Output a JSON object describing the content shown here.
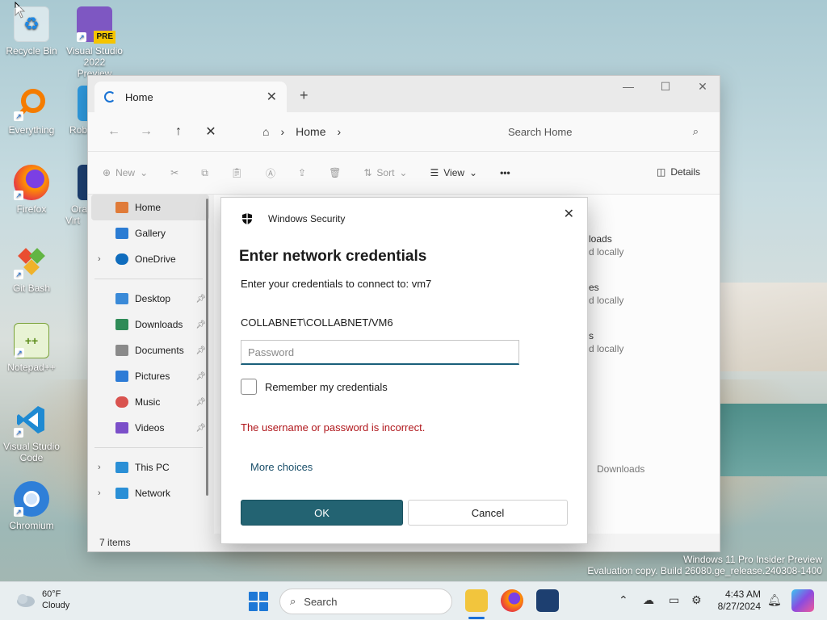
{
  "desktop": {
    "icons": [
      {
        "label": "Recycle Bin"
      },
      {
        "label": "Visual Studio 2022 Preview",
        "badge": "PRE"
      },
      {
        "label": "Everything"
      },
      {
        "label": "Roblo"
      },
      {
        "label": "Firefox"
      },
      {
        "label": "Ora Virt"
      },
      {
        "label": "Git Bash"
      },
      {
        "label": "Notepad++"
      },
      {
        "label": "Visual Studio Code"
      },
      {
        "label": "Chromium"
      }
    ]
  },
  "explorer": {
    "tab_title": "Home",
    "address": {
      "home_icon": "home-icon",
      "crumb": "Home"
    },
    "search_placeholder": "Search Home",
    "command_bar": {
      "new": "New",
      "sort": "Sort",
      "view": "View",
      "more": "•••",
      "details": "Details"
    },
    "sidebar": {
      "items": [
        {
          "label": "Home",
          "icon": "home-icon",
          "color": "#e07b39"
        },
        {
          "label": "Gallery",
          "icon": "gallery-icon",
          "color": "#2b7cd3"
        },
        {
          "label": "OneDrive",
          "icon": "cloud-icon",
          "color": "#0f6cbd"
        },
        {
          "label": "Desktop",
          "icon": "desktop-icon",
          "color": "#3a8ad8"
        },
        {
          "label": "Downloads",
          "icon": "download-icon",
          "color": "#2e8b57"
        },
        {
          "label": "Documents",
          "icon": "document-icon",
          "color": "#8a8a8a"
        },
        {
          "label": "Pictures",
          "icon": "pictures-icon",
          "color": "#2d7bd6"
        },
        {
          "label": "Music",
          "icon": "music-icon",
          "color": "#d9534f"
        },
        {
          "label": "Videos",
          "icon": "videos-icon",
          "color": "#7b4fc9"
        },
        {
          "label": "This PC",
          "icon": "pc-icon",
          "color": "#2a8fd6"
        },
        {
          "label": "Network",
          "icon": "network-icon",
          "color": "#2a8fd6"
        }
      ]
    },
    "content": {
      "frag1": "loads",
      "frag1_sub": "d locally",
      "frag2": "es",
      "frag2_sub": "d locally",
      "frag3": "s",
      "frag3_sub": "d locally",
      "frag4": "Downloads"
    },
    "status": "7 items"
  },
  "dialog": {
    "app_name": "Windows Security",
    "title": "Enter network credentials",
    "prompt": "Enter your credentials to connect to: vm7",
    "username": "COLLABNET\\COLLABNET/VM6",
    "password_placeholder": "Password",
    "remember_label": "Remember my credentials",
    "error": "The username or password is incorrect.",
    "more_choices": "More choices",
    "ok": "OK",
    "cancel": "Cancel"
  },
  "watermark": {
    "line1": "Windows 11 Pro Insider Preview",
    "line2": "Evaluation copy. Build 26080.ge_release.240308-1400"
  },
  "taskbar": {
    "weather_temp": "60°F",
    "weather_desc": "Cloudy",
    "search_label": "Search",
    "time": "4:43 AM",
    "date": "8/27/2024"
  }
}
